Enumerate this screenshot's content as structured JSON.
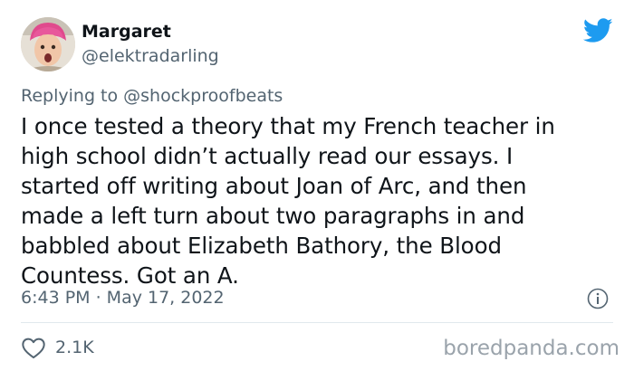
{
  "author": {
    "name": "Margaret",
    "handle": "@elektradarling"
  },
  "reply": {
    "prefix": "Replying to ",
    "mention": "@shockproofbeats"
  },
  "body_lines": [
    "I once tested a theory that my French teacher in",
    "high school didn’t actually read our essays. I",
    "started off writing about Joan of Arc, and then",
    "made a left turn about two paragraphs in and",
    "babbled about Elizabeth Bathory, the Blood",
    "Countess. Got an A."
  ],
  "timestamp": "6:43 PM · May 17, 2022",
  "likes": "2.1K",
  "watermark": "boredpanda.com",
  "colors": {
    "twitter_blue": "#1d9bf0",
    "secondary_text": "#536471",
    "primary_text": "#0f1419"
  },
  "icons": {
    "logo": "twitter-bird-icon",
    "info": "info-icon",
    "like": "heart-icon"
  }
}
